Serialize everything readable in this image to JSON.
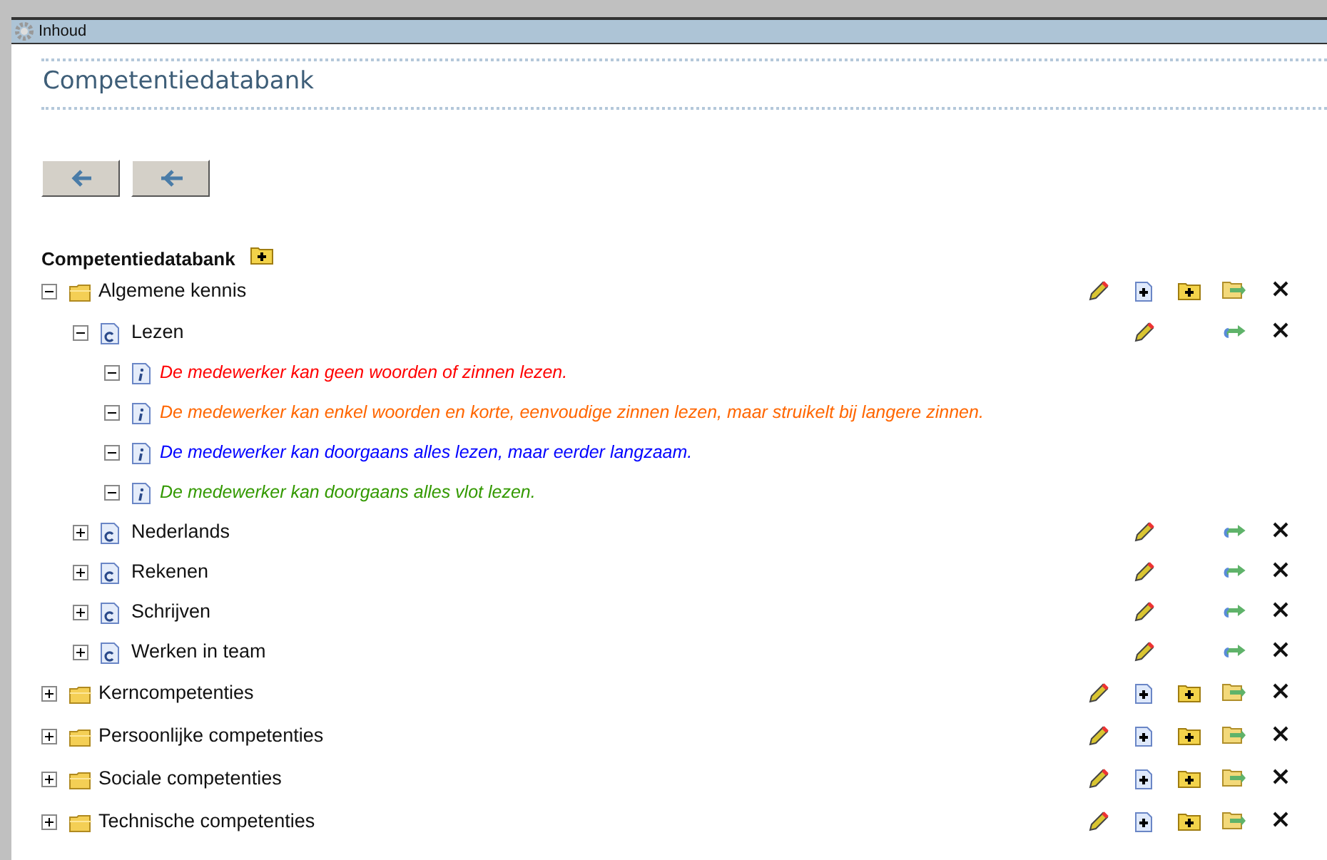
{
  "window": {
    "title": "Inhoud"
  },
  "heading": "Competentiedatabank",
  "nav_buttons": [
    {
      "kind": "back"
    },
    {
      "kind": "up"
    }
  ],
  "tree": {
    "root": "Competentiedatabank",
    "items": [
      {
        "kind": "folder",
        "label": "Algemene kennis",
        "expanded": true,
        "children": [
          {
            "kind": "competence",
            "label": "Lezen",
            "expanded": true,
            "children": [
              {
                "kind": "indicator",
                "label": "De medewerker kan geen woorden of zinnen lezen.",
                "color": "#ff0000",
                "expanded": true
              },
              {
                "kind": "indicator",
                "label": "De medewerker kan enkel woorden en korte, eenvoudige zinnen lezen, maar struikelt bij langere zinnen.",
                "color": "#ff6600",
                "expanded": true
              },
              {
                "kind": "indicator",
                "label": "De medewerker kan doorgaans alles lezen, maar eerder langzaam.",
                "color": "#0000ff",
                "expanded": true
              },
              {
                "kind": "indicator",
                "label": "De medewerker kan doorgaans alles vlot lezen.",
                "color": "#339900",
                "expanded": true
              }
            ]
          },
          {
            "kind": "competence",
            "label": "Nederlands",
            "expanded": false
          },
          {
            "kind": "competence",
            "label": "Rekenen",
            "expanded": false
          },
          {
            "kind": "competence",
            "label": "Schrijven",
            "expanded": false
          },
          {
            "kind": "competence",
            "label": "Werken in team",
            "expanded": false
          }
        ]
      },
      {
        "kind": "folder",
        "label": "Kerncompetenties",
        "expanded": false
      },
      {
        "kind": "folder",
        "label": "Persoonlijke competenties",
        "expanded": false
      },
      {
        "kind": "folder",
        "label": "Sociale competenties",
        "expanded": false
      },
      {
        "kind": "folder",
        "label": "Technische competenties",
        "expanded": false
      }
    ]
  }
}
